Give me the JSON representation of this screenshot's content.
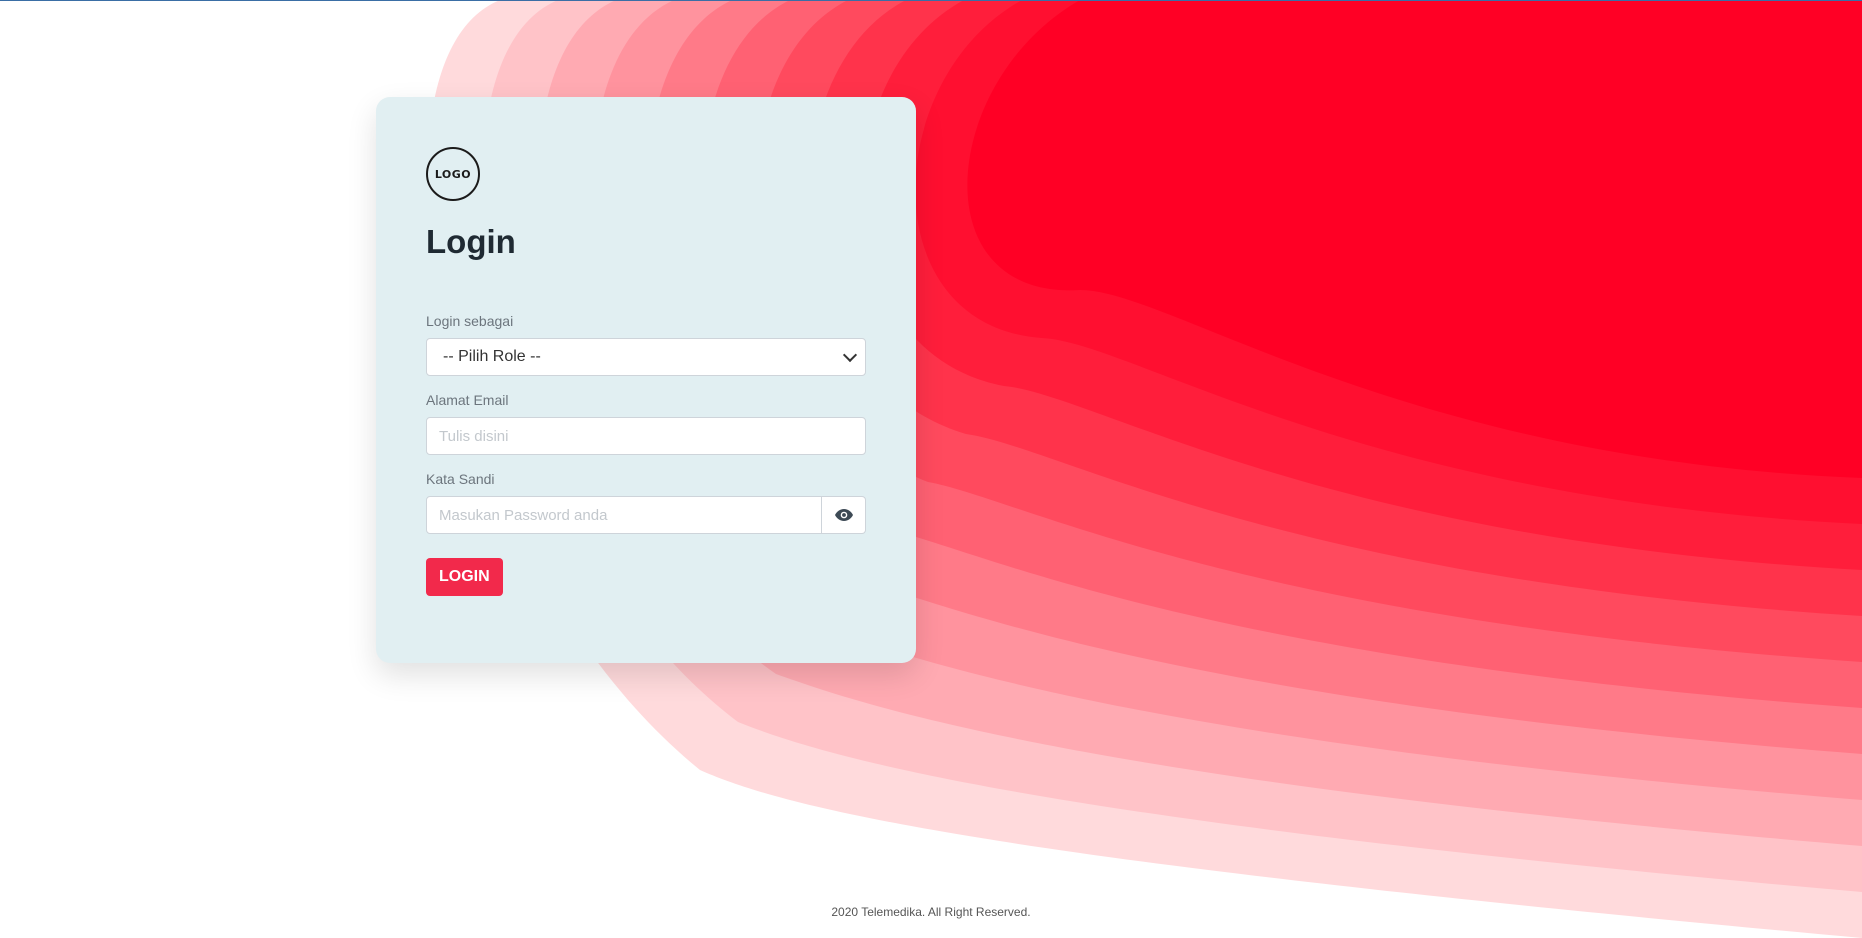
{
  "brand": {
    "logo_text": "LOGO",
    "accent_color": "#f2294b",
    "wave_colors": [
      "#ffdadc",
      "#ffc3c8",
      "#ffaab2",
      "#ff939e",
      "#ff7a88",
      "#ff6173",
      "#ff4a5e",
      "#ff334b",
      "#ff1e3b",
      "#ff0f30",
      "#ff0025"
    ]
  },
  "login": {
    "title": "Login",
    "role_label": "Login sebagai",
    "role_selected": "-- Pilih Role --",
    "email_label": "Alamat Email",
    "email_placeholder": "Tulis disini",
    "password_label": "Kata Sandi",
    "password_placeholder": "Masukan Password anda",
    "password_toggle_icon": "eye-icon",
    "submit_label": "LOGIN"
  },
  "footer": {
    "copyright": "2020 Telemedika. All Right Reserved."
  }
}
